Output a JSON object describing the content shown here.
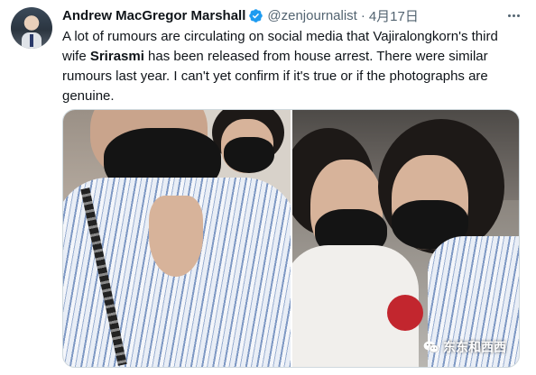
{
  "tweet": {
    "author_name": "Andrew MacGregor Marshall",
    "author_handle": "@zenjournalist",
    "separator": "·",
    "date": "4月17日",
    "text_before": "A lot of rumours are circulating on social media that Vajiralongkorn's third wife ",
    "text_bold": "Srirasmi",
    "text_after": " has been released from house arrest. There were similar rumours last year. I can't yet confirm if it's true or if the photographs are genuine.",
    "verified_color": "#1d9bf0",
    "icons": [
      "verified-badge-icon",
      "more-options-icon"
    ]
  },
  "watermark": {
    "text": "东东和西西",
    "icon": "wechat-icon"
  }
}
